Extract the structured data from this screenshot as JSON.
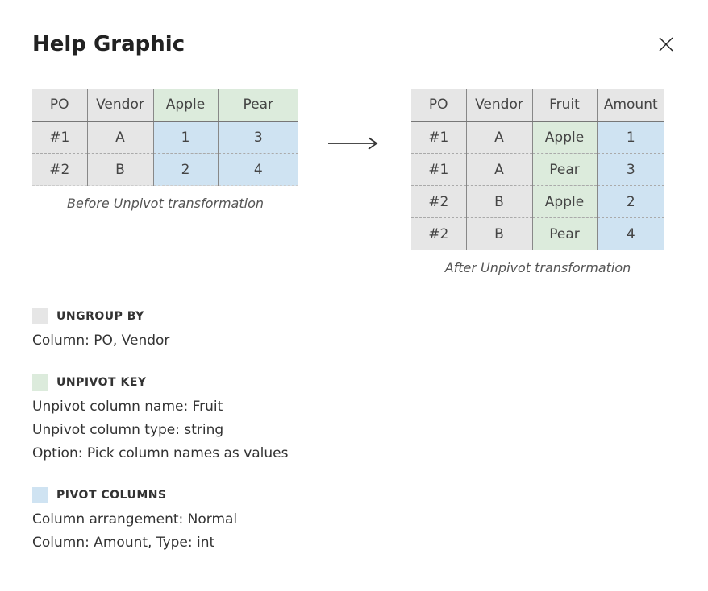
{
  "header": {
    "title": "Help Graphic"
  },
  "before": {
    "caption": "Before Unpivot transformation",
    "headers": [
      "PO",
      "Vendor",
      "Apple",
      "Pear"
    ],
    "rows": [
      [
        "#1",
        "A",
        "1",
        "3"
      ],
      [
        "#2",
        "B",
        "2",
        "4"
      ]
    ]
  },
  "after": {
    "caption": "After Unpivot transformation",
    "headers": [
      "PO",
      "Vendor",
      "Fruit",
      "Amount"
    ],
    "rows": [
      [
        "#1",
        "A",
        "Apple",
        "1"
      ],
      [
        "#1",
        "A",
        "Pear",
        "3"
      ],
      [
        "#2",
        "B",
        "Apple",
        "2"
      ],
      [
        "#2",
        "B",
        "Pear",
        "4"
      ]
    ]
  },
  "legend": {
    "ungroup": {
      "title": "UNGROUP BY",
      "details": [
        "Column: PO, Vendor"
      ]
    },
    "unpivot_key": {
      "title": "UNPIVOT KEY",
      "details": [
        "Unpivot column name: Fruit",
        "Unpivot column type: string",
        "Option: Pick column names as values"
      ]
    },
    "pivot_cols": {
      "title": "PIVOT COLUMNS",
      "details": [
        "Column arrangement: Normal",
        "Column: Amount, Type: int"
      ]
    }
  },
  "colors": {
    "gray": "#e6e6e6",
    "green": "#dcebdc",
    "blue": "#cfe3f2"
  }
}
